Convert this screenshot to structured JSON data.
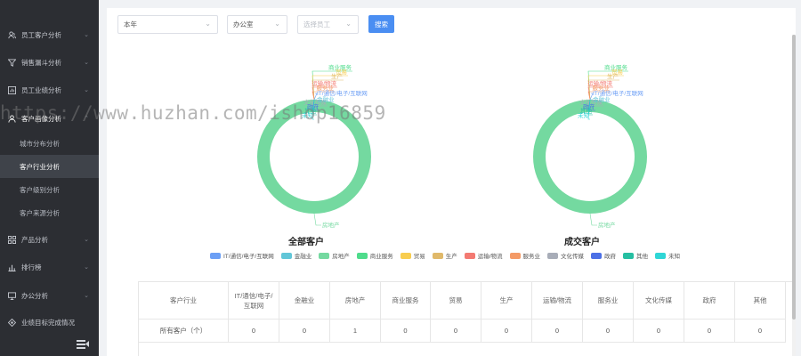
{
  "sidebar": {
    "items": [
      {
        "label": "员工客户分析",
        "icon": "users-icon"
      },
      {
        "label": "销售漏斗分析",
        "icon": "funnel-icon"
      },
      {
        "label": "员工业绩分析",
        "icon": "bar-chart-icon"
      },
      {
        "label": "客户画像分析",
        "icon": "person-icon"
      },
      {
        "label": "产品分析",
        "icon": "grid-icon"
      },
      {
        "label": "排行榜",
        "icon": "ranking-icon"
      },
      {
        "label": "办公分析",
        "icon": "monitor-icon"
      },
      {
        "label": "业绩目标完成情况",
        "icon": "target-icon"
      }
    ],
    "sub_items": [
      "城市分布分析",
      "客户行业分析",
      "客户级别分析",
      "客户来源分析"
    ],
    "active_sub": "客户行业分析"
  },
  "filters": {
    "period": "本年",
    "department": "办公室",
    "employee_placeholder": "选择员工",
    "search_label": "搜索"
  },
  "watermark": "https://www.huzhan.com/ishop16859",
  "colors": {
    "IT/通信/电子/互联网": "#6c9ff5",
    "金融业": "#62c6d8",
    "房地产": "#74d9a0",
    "商业服务": "#4fdc8c",
    "贸易": "#f8cd4f",
    "生产": "#e0b96a",
    "运输/物流": "#f37a72",
    "服务业": "#f49a66",
    "文化传媒": "#a8adb8",
    "政府": "#4c70e6",
    "其他": "#26bfa2",
    "未知": "#2fd6d6"
  },
  "chart_data": [
    {
      "type": "pie",
      "title": "全部客户",
      "categories": [
        "IT/通信/电子/互联网",
        "金融业",
        "房地产",
        "商业服务",
        "贸易",
        "生产",
        "运输/物流",
        "服务业",
        "文化传媒",
        "政府",
        "其他",
        "未知"
      ],
      "values": [
        0,
        0,
        1,
        0,
        0,
        0,
        0,
        0,
        0,
        0,
        0,
        0
      ],
      "style": "donut",
      "legend": "bottom"
    },
    {
      "type": "pie",
      "title": "成交客户",
      "categories": [
        "IT/通信/电子/互联网",
        "金融业",
        "房地产",
        "商业服务",
        "贸易",
        "生产",
        "运输/物流",
        "服务业",
        "文化传媒",
        "政府",
        "其他",
        "未知"
      ],
      "values": [
        0,
        0,
        1,
        0,
        0,
        0,
        0,
        0,
        0,
        0,
        0,
        0
      ],
      "style": "donut",
      "legend": "bottom"
    }
  ],
  "legend_items": [
    "IT/通信/电子/互联网",
    "金融业",
    "房地产",
    "商业服务",
    "贸易",
    "生产",
    "运输/物流",
    "服务业",
    "文化传媒",
    "政府",
    "其他",
    "未知"
  ],
  "callout_labels": {
    "top": [
      "商业服务",
      "贸易",
      "生产",
      "运输/物流",
      "服务业",
      "文化传媒",
      "政府",
      "其他",
      "未知"
    ],
    "right": [
      "IT/通信/电子/互联网",
      "金融业"
    ],
    "bottom": "房地产"
  },
  "table": {
    "headers": [
      "客户行业",
      "IT/通信/电子/互联网",
      "金融业",
      "房地产",
      "商业服务",
      "贸易",
      "生产",
      "运输/物流",
      "服务业",
      "文化传媒",
      "政府",
      "其他"
    ],
    "rows": [
      [
        "所有客户（个）",
        "0",
        "0",
        "1",
        "0",
        "0",
        "0",
        "0",
        "0",
        "0",
        "0",
        "0"
      ]
    ]
  }
}
